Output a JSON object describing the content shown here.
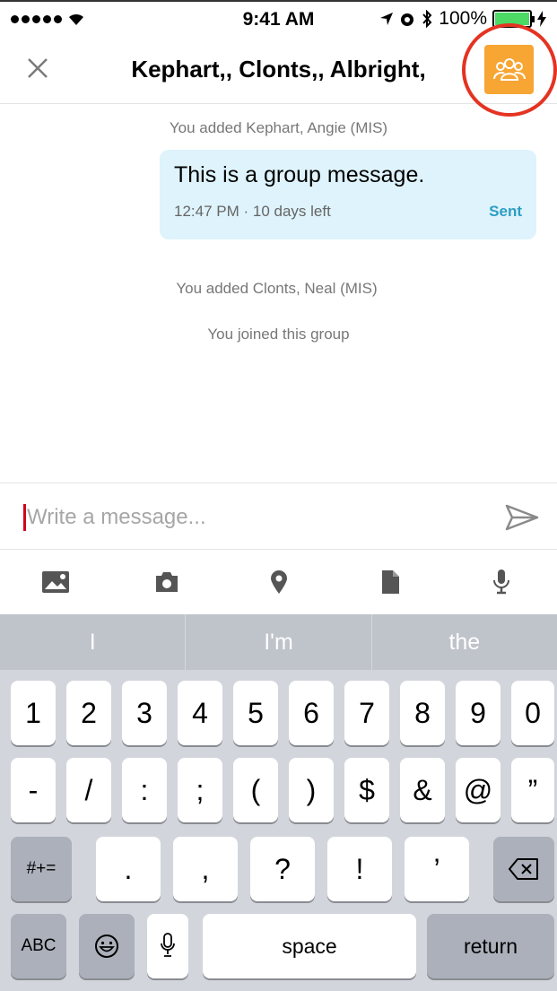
{
  "status_bar": {
    "time": "9:41 AM",
    "battery": "100%"
  },
  "nav": {
    "title": "Kephart,, Clonts,, Albright,",
    "close_icon": "close-icon",
    "group_icon": "group-members-icon",
    "group_button_color": "#f7a533",
    "highlight_color": "#e53322"
  },
  "messages": {
    "system_1": "You added Kephart, Angie (MIS)",
    "bubble": {
      "text": "This is a group message.",
      "time": "12:47 PM · 10 days left",
      "status": "Sent"
    },
    "system_2": "You added Clonts, Neal (MIS)",
    "system_3": "You joined this group"
  },
  "composer": {
    "placeholder": "Write a message..."
  },
  "attachments": [
    "image-icon",
    "camera-icon",
    "location-pin-icon",
    "document-icon",
    "microphone-icon"
  ],
  "keyboard": {
    "suggestions": [
      "I",
      "I'm",
      "the"
    ],
    "row1": [
      "1",
      "2",
      "3",
      "4",
      "5",
      "6",
      "7",
      "8",
      "9",
      "0"
    ],
    "row2": [
      "-",
      "/",
      ":",
      ";",
      "(",
      ")",
      "$",
      "&",
      "@",
      "”"
    ],
    "row3_left": "#+=",
    "row3": [
      ".",
      ",",
      "?",
      "!",
      "’"
    ],
    "row4": {
      "abc": "ABC",
      "space": "space",
      "return": "return"
    }
  }
}
